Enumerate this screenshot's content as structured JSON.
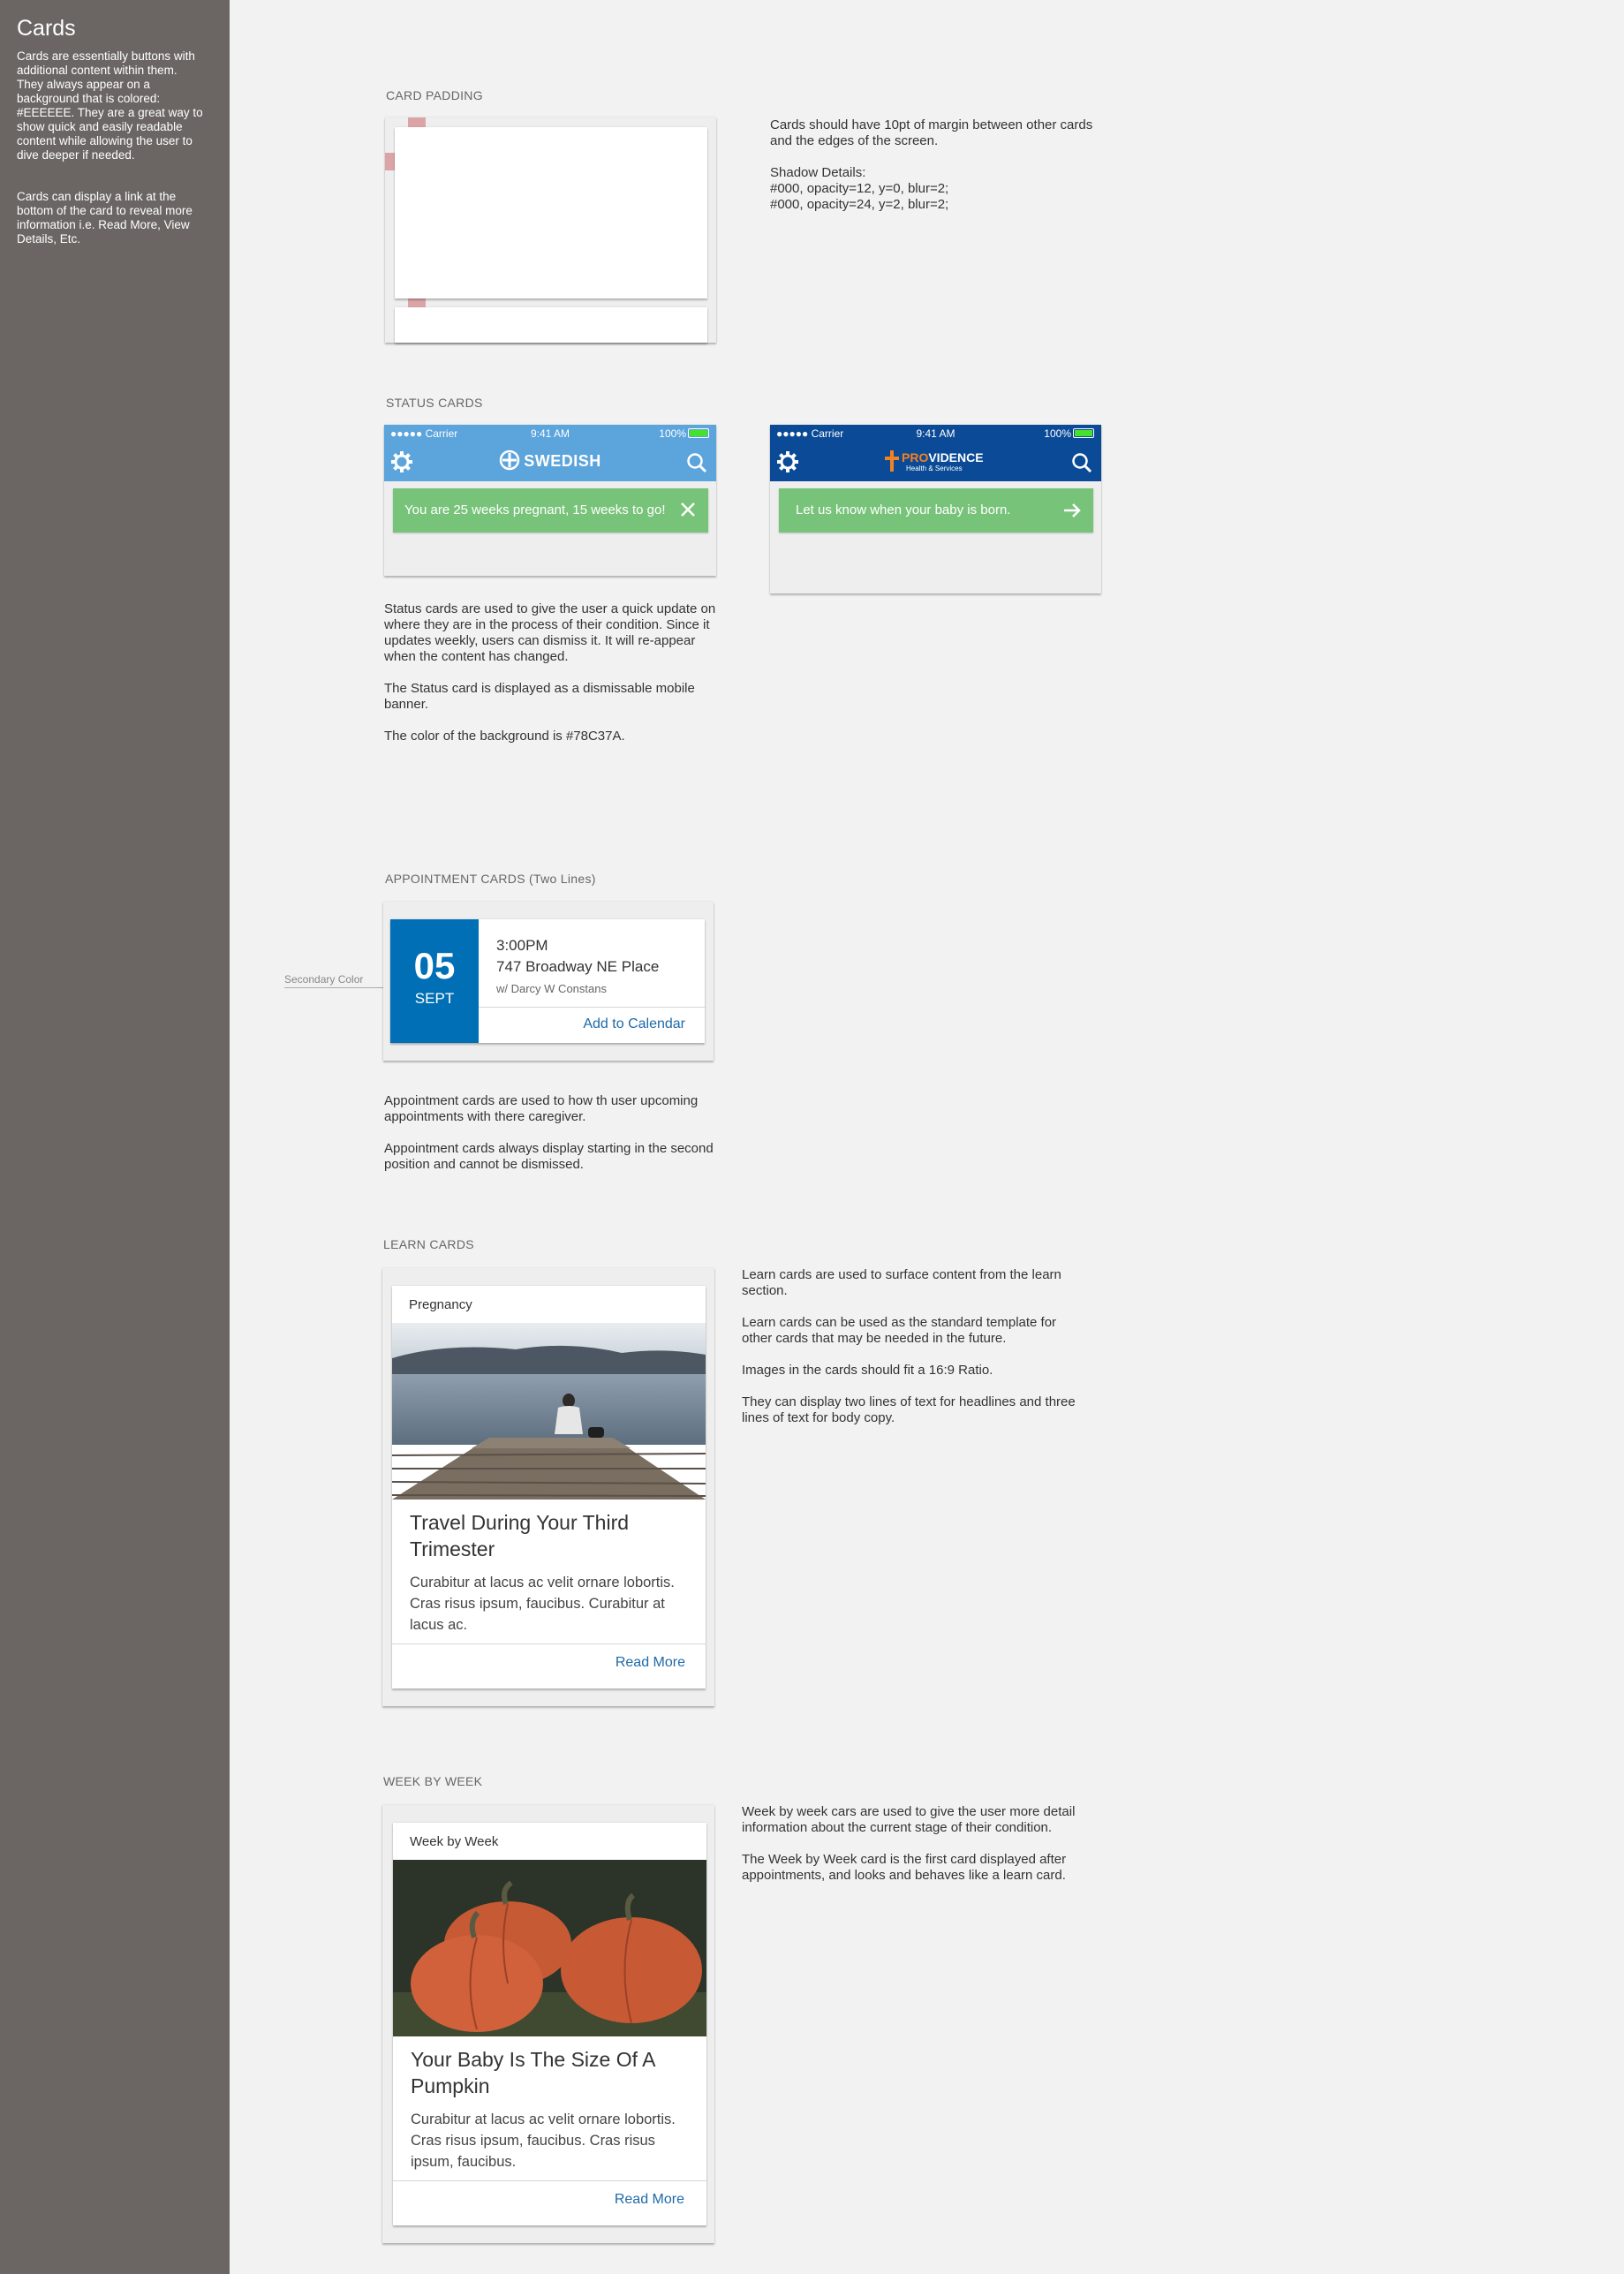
{
  "sidebar": {
    "title": "Cards",
    "para1": "Cards are essentially buttons with additional content within them. They always appear on a background that is colored: #EEEEEE. They are a great way to show quick and easily readable content while allowing the user to dive deeper if needed.",
    "para2": "Cards  can display a link at the bottom of the card to reveal more information i.e. Read More, View Details, Etc."
  },
  "card_padding": {
    "title": "CARD PADDING",
    "desc1": "Cards should have 10pt of margin between other cards and the edges of the screen.",
    "desc2": "Shadow Details:",
    "desc3": "#000, opacity=12, y=0, blur=2;",
    "desc4": "#000, opacity=24, y=2, blur=2;"
  },
  "status_cards": {
    "title": "STATUS CARDS",
    "statusbar": {
      "carrier": "●●●●● Carrier",
      "time": "9:41 AM",
      "battery": "100%"
    },
    "swedish": {
      "brand": "SWEDISH",
      "message": "You are 25 weeks pregnant, 15 weeks to go!"
    },
    "providence": {
      "brand_pro": "PRO",
      "brand_rest": "VIDENCE",
      "brand_sub": "Health & Services",
      "message": "Let us know when your baby is born."
    },
    "desc1": "Status cards are used to give the user a quick update on where they are in the process of their condition. Since it updates weekly, users can dismiss it. It will re-appear when the content has changed.",
    "desc2": "The Status card is displayed as a dismissable mobile banner.",
    "desc3": "The color of the background is #78C37A.",
    "colors": {
      "swedish_nav": "#5ba4dc",
      "providence_nav": "#0a4a96",
      "banner": "#78C37A"
    }
  },
  "appointment": {
    "title": "APPOINTMENT CARDS (Two Lines)",
    "secondary_label": "Secondary Color",
    "day": "05",
    "month": "SEPT",
    "time": "3:00PM",
    "place": "747 Broadway NE Place",
    "with": "w/ Darcy W Constans",
    "action": "Add to Calendar",
    "desc1": "Appointment cards are used to how th user upcoming appointments with there caregiver.",
    "desc2": "Appointment cards always display starting in the second position and cannot be dismissed."
  },
  "learn": {
    "title": "LEARN CARDS",
    "tag": "Pregnancy",
    "headline": "Travel During Your Third Trimester",
    "body": "Curabitur at lacus ac velit ornare lobortis. Cras risus ipsum, faucibus. Curabitur at lacus ac.",
    "action": "Read More",
    "desc1": "Learn cards are used to surface content from the learn section.",
    "desc2": "Learn cards can be used as the standard template for other cards that may be needed in the future.",
    "desc3": "Images in the cards should fit a 16:9 Ratio.",
    "desc4": "They can display two lines of text for headlines and three lines of text for body copy."
  },
  "week": {
    "title": "WEEK BY WEEK",
    "tag": "Week by Week",
    "headline": "Your Baby Is The Size Of A Pumpkin",
    "body": "Curabitur at lacus ac velit ornare lobortis. Cras risus ipsum, faucibus. Cras risus ipsum, faucibus.",
    "action": "Read More",
    "desc1": "Week by week cars are used to give the user more detail information about the current stage of their condition.",
    "desc2": "The Week by Week card is the first card displayed after appointments, and looks and behaves like a learn card."
  }
}
